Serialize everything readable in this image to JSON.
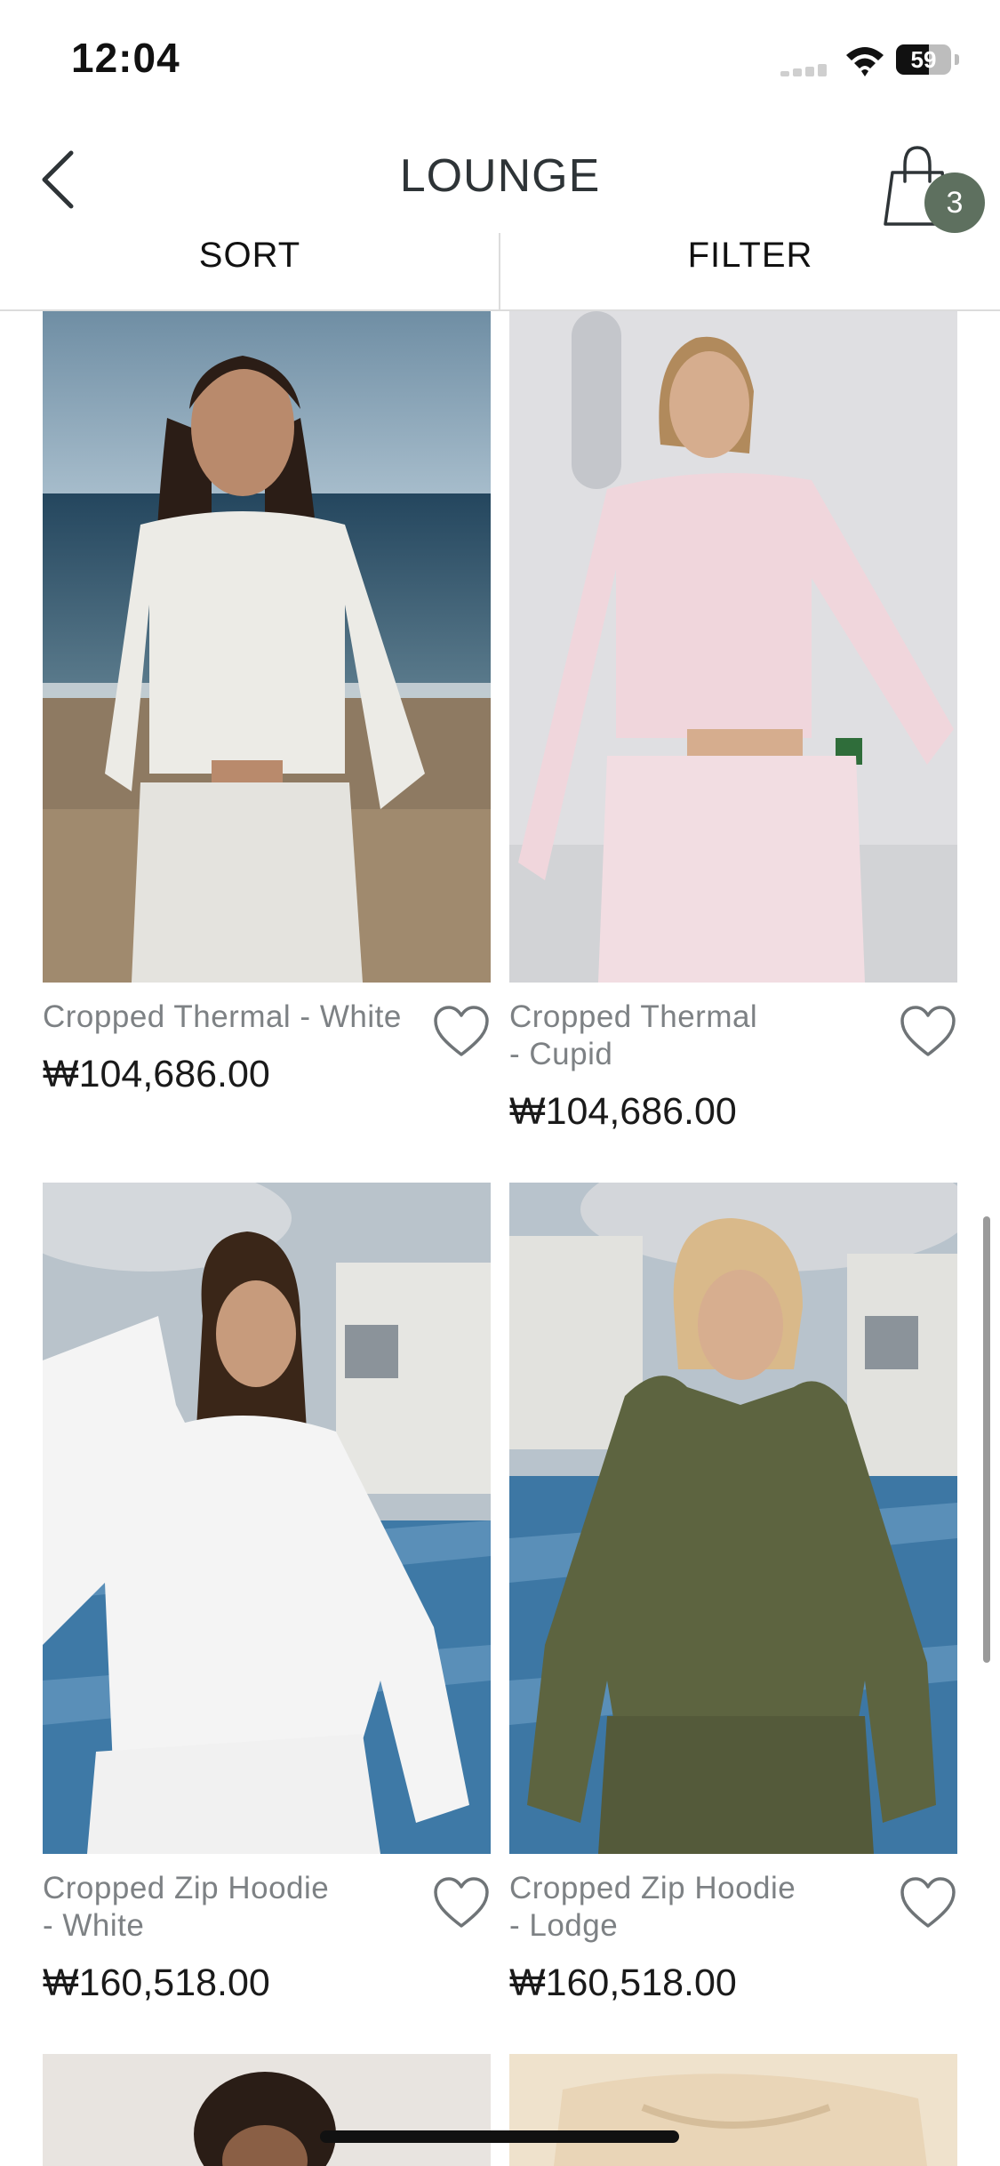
{
  "status": {
    "time": "12:04",
    "battery": "59"
  },
  "nav": {
    "title": "LOUNGE",
    "cart_count": "3"
  },
  "toolbar": {
    "sort_label": "SORT",
    "filter_label": "FILTER"
  },
  "products": [
    {
      "name": "Cropped Thermal - White",
      "price": "₩104,686.00"
    },
    {
      "name": "Cropped Thermal\n- Cupid",
      "price": "₩104,686.00"
    },
    {
      "name": "Cropped Zip Hoodie\n- White",
      "price": "₩160,518.00"
    },
    {
      "name": "Cropped Zip Hoodie\n- Lodge",
      "price": "₩160,518.00"
    }
  ],
  "icons": {
    "back": "chevron-left-icon",
    "cart": "shopping-bag-icon",
    "favorite": "heart-icon",
    "wifi": "wifi-icon",
    "battery": "battery-icon"
  },
  "colors": {
    "badge": "#5e705f",
    "title": "#2e3437",
    "product_name": "#7d8184"
  }
}
